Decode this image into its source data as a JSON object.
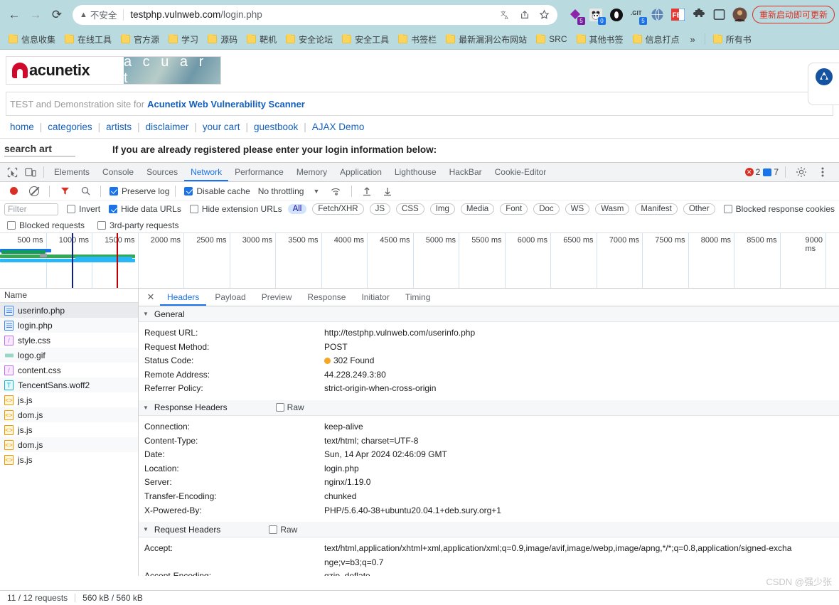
{
  "browser": {
    "nav": {
      "back": "←",
      "forward": "→",
      "reload": "⟳"
    },
    "omnibox": {
      "security_label": "不安全",
      "security_icon": "warning-triangle-icon",
      "url_host": "testphp.vulnweb.com",
      "url_path": "/login.php",
      "translate_icon": "translate-icon",
      "share_icon": "share-icon",
      "bookmark_icon": "star-icon"
    },
    "extensions": [
      {
        "name": "purple-diamond-extension",
        "badge": "5",
        "badge_color": "#7b1fa2",
        "color": "#8e24aa"
      },
      {
        "name": "panda-extension",
        "badge": "0",
        "badge_color": "#1a73e8",
        "color": "#dddddd"
      },
      {
        "name": "black-circle-extension",
        "badge": "",
        "badge_color": "",
        "color": "#111111"
      },
      {
        "name": "git-extension",
        "badge": "5",
        "badge_color": "#1a73e8",
        "color": "#3c4043"
      },
      {
        "name": "globe-extension",
        "badge": "",
        "badge_color": "",
        "color": "#4a6fa5"
      },
      {
        "name": "fe-extension",
        "badge": "",
        "badge_color": "",
        "color": "#e53935"
      },
      {
        "name": "puzzle-extensions-icon",
        "badge": "",
        "badge_color": "",
        "color": "#3c4043"
      },
      {
        "name": "sidepanel-icon",
        "badge": "",
        "badge_color": "",
        "color": "#3c4043"
      },
      {
        "name": "profile-avatar",
        "badge": "",
        "badge_color": "",
        "color": "#8d6e63"
      }
    ],
    "update_pill": "重新启动即可更新",
    "bookmarks": [
      "信息收集",
      "在线工具",
      "官方源",
      "学习",
      "源码",
      "靶机",
      "安全论坛",
      "安全工具",
      "书签栏",
      "最新漏洞公布网站",
      "SRC",
      "其他书签",
      "信息打点"
    ],
    "bookmarks_overflow": "»",
    "bookmarks_all": "所有书"
  },
  "page": {
    "logo_text": "acunetix",
    "logo_sub": "a c u a r t",
    "tagline_grey": "TEST and Demonstration site for",
    "tagline_link": "Acunetix Web Vulnerability Scanner",
    "nav": [
      "home",
      "categories",
      "artists",
      "disclaimer",
      "your cart",
      "guestbook",
      "AJAX Demo"
    ],
    "search_title": "search art",
    "login_message": "If you are already registered please enter your login information below:"
  },
  "devtools": {
    "panel_tabs": [
      "Elements",
      "Console",
      "Sources",
      "Network",
      "Performance",
      "Memory",
      "Application",
      "Lighthouse",
      "HackBar",
      "Cookie-Editor"
    ],
    "active_panel": "Network",
    "inspect_icon": "inspect-element-icon",
    "device_icon": "device-toolbar-icon",
    "errors_count": "2",
    "warnings_count": "7",
    "settings_icon": "gear-icon",
    "more_icon": "kebab-menu-icon",
    "network_toolbar": {
      "record_icon": "record-stop-icon",
      "clear_icon": "clear-icon",
      "filter_icon": "filter-icon",
      "search_icon": "search-icon",
      "preserve_log": {
        "label": "Preserve log",
        "checked": true
      },
      "disable_cache": {
        "label": "Disable cache",
        "checked": true
      },
      "throttling": "No throttling",
      "throttle_caret": "▼",
      "wifi_icon": "network-conditions-icon",
      "import_icon": "import-har-icon",
      "export_icon": "export-har-icon"
    },
    "filter_bar": {
      "placeholder": "Filter",
      "value": "",
      "invert": {
        "label": "Invert",
        "checked": false
      },
      "hide_data_urls": {
        "label": "Hide data URLs",
        "checked": true
      },
      "hide_extension_urls": {
        "label": "Hide extension URLs",
        "checked": false
      },
      "types": [
        "All",
        "Fetch/XHR",
        "JS",
        "CSS",
        "Img",
        "Media",
        "Font",
        "Doc",
        "WS",
        "Wasm",
        "Manifest",
        "Other"
      ],
      "active_type": "All",
      "blocked_response_cookies": {
        "label": "Blocked response cookies",
        "checked": false
      },
      "blocked_requests": {
        "label": "Blocked requests",
        "checked": false
      },
      "third_party_requests": {
        "label": "3rd-party requests",
        "checked": false
      }
    },
    "overview": {
      "ticks": [
        "500 ms",
        "1000 ms",
        "1500 ms",
        "2000 ms",
        "2500 ms",
        "3000 ms",
        "3500 ms",
        "4000 ms",
        "4500 ms",
        "5000 ms",
        "5500 ms",
        "6000 ms",
        "6500 ms",
        "7000 ms",
        "7500 ms",
        "8000 ms",
        "8500 ms",
        "9000 ms"
      ]
    },
    "requests": {
      "column_header": "Name",
      "rows": [
        {
          "name": "userinfo.php",
          "type": "doc",
          "selected": true
        },
        {
          "name": "login.php",
          "type": "doc",
          "selected": false
        },
        {
          "name": "style.css",
          "type": "css",
          "selected": false
        },
        {
          "name": "logo.gif",
          "type": "img",
          "selected": false
        },
        {
          "name": "content.css",
          "type": "css",
          "selected": false
        },
        {
          "name": "TencentSans.woff2",
          "type": "font",
          "selected": false
        },
        {
          "name": "js.js",
          "type": "js",
          "selected": false
        },
        {
          "name": "dom.js",
          "type": "js",
          "selected": false
        },
        {
          "name": "js.js",
          "type": "js",
          "selected": false
        },
        {
          "name": "dom.js",
          "type": "js",
          "selected": false
        },
        {
          "name": "js.js",
          "type": "js",
          "selected": false
        }
      ]
    },
    "detail": {
      "close_icon": "close-icon",
      "tabs": [
        "Headers",
        "Payload",
        "Preview",
        "Response",
        "Initiator",
        "Timing"
      ],
      "active_tab": "Headers",
      "general": {
        "title": "General",
        "rows": [
          {
            "key": "Request URL:",
            "value": "http://testphp.vulnweb.com/userinfo.php"
          },
          {
            "key": "Request Method:",
            "value": "POST"
          },
          {
            "key": "Status Code:",
            "value": "302 Found",
            "status_dot": "#f5a623"
          },
          {
            "key": "Remote Address:",
            "value": "44.228.249.3:80"
          },
          {
            "key": "Referrer Policy:",
            "value": "strict-origin-when-cross-origin"
          }
        ]
      },
      "response_headers": {
        "title": "Response Headers",
        "raw_label": "Raw",
        "raw_checked": false,
        "rows": [
          {
            "key": "Connection:",
            "value": "keep-alive"
          },
          {
            "key": "Content-Type:",
            "value": "text/html; charset=UTF-8"
          },
          {
            "key": "Date:",
            "value": "Sun, 14 Apr 2024 02:46:09 GMT"
          },
          {
            "key": "Location:",
            "value": "login.php"
          },
          {
            "key": "Server:",
            "value": "nginx/1.19.0"
          },
          {
            "key": "Transfer-Encoding:",
            "value": "chunked"
          },
          {
            "key": "X-Powered-By:",
            "value": "PHP/5.6.40-38+ubuntu20.04.1+deb.sury.org+1"
          }
        ]
      },
      "request_headers": {
        "title": "Request Headers",
        "raw_label": "Raw",
        "raw_checked": false,
        "rows": [
          {
            "key": "Accept:",
            "value": "text/html,application/xhtml+xml,application/xml;q=0.9,image/avif,image/webp,image/apng,*/*;q=0.8,application/signed-exchange;v=b3;q=0.7"
          },
          {
            "key": "Accept-Encoding:",
            "value": "gzip, deflate"
          }
        ]
      }
    },
    "statusbar": {
      "requests": "11 / 12 requests",
      "transferred": "560 kB / 560 kB"
    }
  },
  "watermark": "CSDN @强少张"
}
